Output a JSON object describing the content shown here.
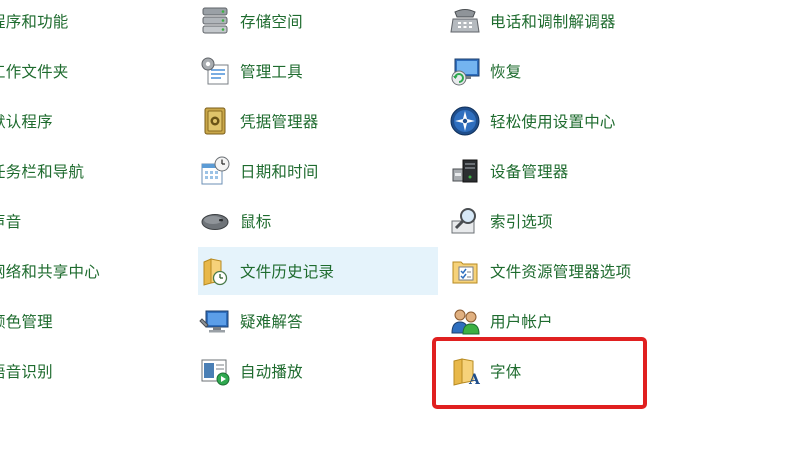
{
  "col1": [
    {
      "label": "程序和功能"
    },
    {
      "label": "工作文件夹"
    },
    {
      "label": "默认程序"
    },
    {
      "label": "任务栏和导航"
    },
    {
      "label": "声音"
    },
    {
      "label": "网络和共享中心"
    },
    {
      "label": "颜色管理"
    },
    {
      "label": "语音识别"
    }
  ],
  "col2": [
    {
      "label": "存储空间",
      "icon": "storage-icon"
    },
    {
      "label": "管理工具",
      "icon": "admin-tools-icon"
    },
    {
      "label": "凭据管理器",
      "icon": "credential-vault-icon"
    },
    {
      "label": "日期和时间",
      "icon": "calendar-clock-icon"
    },
    {
      "label": "鼠标",
      "icon": "mouse-icon"
    },
    {
      "label": "文件历史记录",
      "icon": "file-history-icon"
    },
    {
      "label": "疑难解答",
      "icon": "troubleshoot-icon"
    },
    {
      "label": "自动播放",
      "icon": "autoplay-icon"
    }
  ],
  "col3": [
    {
      "label": "电话和调制解调器",
      "icon": "phone-modem-icon"
    },
    {
      "label": "恢复",
      "icon": "recovery-icon"
    },
    {
      "label": "轻松使用设置中心",
      "icon": "ease-of-access-icon"
    },
    {
      "label": "设备管理器",
      "icon": "device-manager-icon"
    },
    {
      "label": "索引选项",
      "icon": "indexing-icon"
    },
    {
      "label": "文件资源管理器选项",
      "icon": "explorer-options-icon"
    },
    {
      "label": "用户帐户",
      "icon": "user-accounts-icon"
    },
    {
      "label": "字体",
      "icon": "fonts-folder-icon"
    }
  ],
  "colors": {
    "label": "#1e6b2e",
    "hover_bg": "#e5f3fb",
    "highlight_border": "#e02020"
  }
}
